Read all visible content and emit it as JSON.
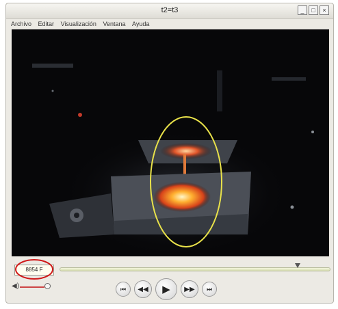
{
  "window": {
    "title": "t2=t3"
  },
  "menu": [
    "Archivo",
    "Editar",
    "Visualización",
    "Ventana",
    "Ayuda"
  ],
  "time_display": "8854 F",
  "seek": {
    "position_fraction": 0.88
  },
  "controls": {
    "prev_icon": "⏮",
    "rewind_icon": "◀◀",
    "play_icon": "▶",
    "forward_icon": "▶▶",
    "next_icon": "⏭"
  },
  "annotations": {
    "ellipse_color": "#e9e24a",
    "circle_color": "#d01818"
  }
}
